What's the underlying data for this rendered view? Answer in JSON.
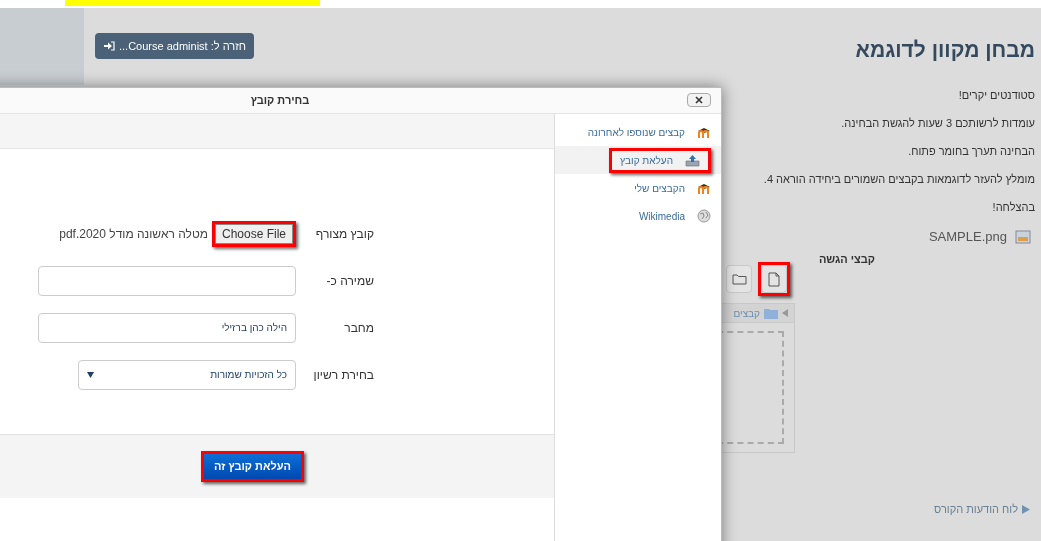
{
  "back_button": {
    "label": "חזרה ל: Course administ..."
  },
  "page": {
    "title": "מבחן מקוון לדוגמא",
    "paragraphs": [
      "סטודנטים יקרים!",
      "עומדות לרשותכם 3 שעות להגשת הבחינה.",
      "הבחינה תערך בחומר פתוח.",
      "מומלץ להעזר לדוגמאות בקבצים השמורים ביחידה הוראה 4.",
      "בהצלחה!"
    ],
    "attachment": "SAMPLE.png",
    "submission": {
      "label": "קבצי הגשה",
      "buttons": [
        {
          "kind": "add-file",
          "highlighted": true
        },
        {
          "kind": "folder",
          "highlighted": false
        }
      ],
      "breadcrumb": "קבצים"
    },
    "course_link": "לוח הודעות הקורס"
  },
  "dialog": {
    "title": "בחירת קובץ",
    "repositories": [
      {
        "label": "קבצים שנוספו לאחרונה",
        "kind": "moodle",
        "selected": false,
        "highlighted": false
      },
      {
        "label": "העלאת קובץ",
        "kind": "upload",
        "selected": true,
        "highlighted": true
      },
      {
        "label": "הקבצים שלי",
        "kind": "moodle",
        "selected": false,
        "highlighted": false
      },
      {
        "label": "Wikimedia",
        "kind": "globe",
        "selected": false,
        "highlighted": false
      }
    ],
    "form": {
      "file_label": "קובץ מצורף",
      "choose_button": "Choose File",
      "choose_highlighted": true,
      "file_name": "מטלה ראשונה מודל 2020.pdf",
      "save_as_label": "שמירה כ-",
      "author_label": "מחבר",
      "author_value": "הילה כהן ברזילי",
      "license_label": "בחירת רשיון",
      "license_value": "כל הזכויות שמורות"
    },
    "submit": {
      "label": "העלאת קובץ זה",
      "highlighted": true
    }
  }
}
